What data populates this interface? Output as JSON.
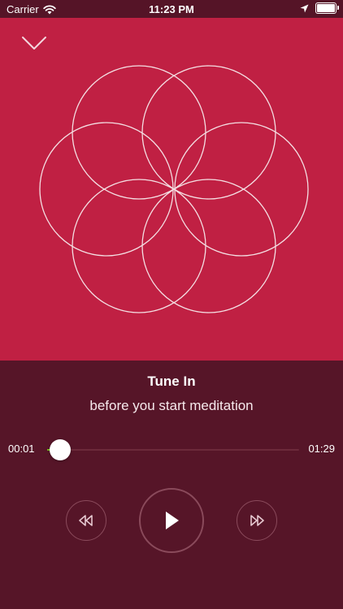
{
  "status_bar": {
    "carrier": "Carrier",
    "time": "11:23 PM",
    "icons": [
      "wifi-icon",
      "location-icon",
      "battery-icon"
    ],
    "battery_level": 1.0
  },
  "artwork": {
    "background_color": "#c02043",
    "icon": "flower-of-life-icon",
    "collapse_icon": "chevron-down-icon"
  },
  "track": {
    "title": "Tune In",
    "subtitle": "before you start meditation"
  },
  "player": {
    "elapsed": "00:01",
    "duration": "01:29",
    "progress": 0.05,
    "accent_color": "#7ed321",
    "controls": [
      "rewind-icon",
      "play-icon",
      "fast-forward-icon"
    ]
  },
  "colors": {
    "panel_background": "#561528"
  }
}
